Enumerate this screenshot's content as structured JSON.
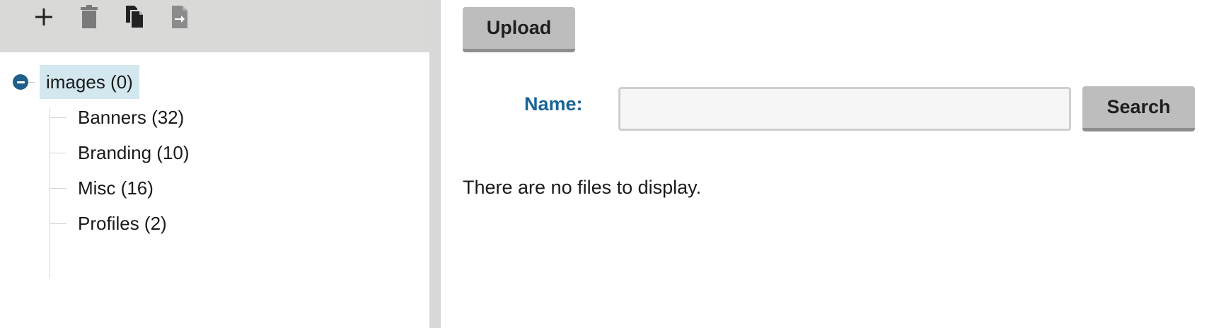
{
  "toolbar": {
    "buttons": [
      {
        "icon": "plus-icon"
      },
      {
        "icon": "trash-icon"
      },
      {
        "icon": "copy-icon"
      },
      {
        "icon": "move-file-icon"
      }
    ],
    "background": "#d9dad8",
    "icon_color_active": "#222222",
    "icon_color_muted": "#7a7a7a"
  },
  "tree": {
    "root": {
      "label": "images (0)",
      "expanded": true,
      "selected": true
    },
    "children": [
      {
        "label": "Banners (32)"
      },
      {
        "label": "Branding (10)"
      },
      {
        "label": "Misc (16)"
      },
      {
        "label": "Profiles (2)"
      }
    ],
    "selection_color": "#d3e7ef",
    "toggle_color": "#1f5f8b"
  },
  "main": {
    "upload_label": "Upload",
    "search": {
      "label": "Name:",
      "value": "",
      "placeholder": "",
      "button_label": "Search"
    },
    "empty_message": "There are no files to display.",
    "label_color": "#1a6496",
    "button_color": "#bdbdbd"
  }
}
